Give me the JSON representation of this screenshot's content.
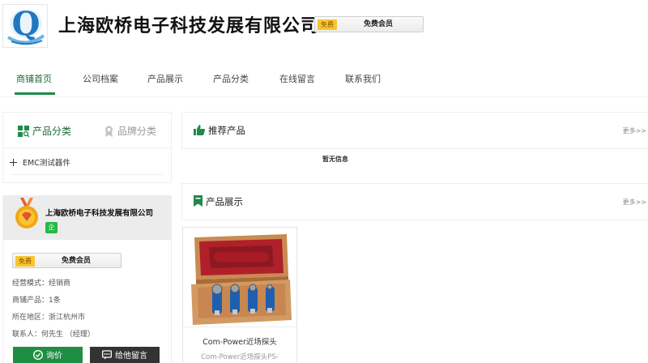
{
  "header": {
    "logo_letter": "Q",
    "company_name": "上海欧桥电子科技发展有限公司",
    "free_tag": "免费",
    "member_label": "免费会员"
  },
  "nav": {
    "items": [
      {
        "label": "商铺首页",
        "active": true
      },
      {
        "label": "公司档案",
        "active": false
      },
      {
        "label": "产品展示",
        "active": false
      },
      {
        "label": "产品分类",
        "active": false
      },
      {
        "label": "在线留言",
        "active": false
      },
      {
        "label": "联系我们",
        "active": false
      }
    ]
  },
  "sidebar": {
    "tab_product_category": "产品分类",
    "tab_brand_category": "品牌分类",
    "categories": [
      "EMC测试器件"
    ]
  },
  "company_card": {
    "name": "上海欧桥电子科技发展有限公司",
    "enterprise_badge": "企",
    "free_tag": "免费",
    "member_label": "免费会员",
    "info": [
      "经营模式：经销商",
      "商铺产品：1条",
      "所在地区：浙江杭州市",
      "联系人：何先生 （经理）"
    ],
    "inquiry_label": "询价",
    "message_label": "给他留言"
  },
  "recommended": {
    "title": "推荐产品",
    "more": "更多>>",
    "empty_text": "暂无信息"
  },
  "showcase": {
    "title": "产品展示",
    "more": "更多>>",
    "products": [
      {
        "name": "Com-Power近场探头",
        "desc": "Com-Power近场探头PS-"
      }
    ]
  },
  "colors": {
    "accent_green": "#1e8a4a",
    "free_tag_yellow": "#f7c531",
    "dark_button": "#333333"
  }
}
